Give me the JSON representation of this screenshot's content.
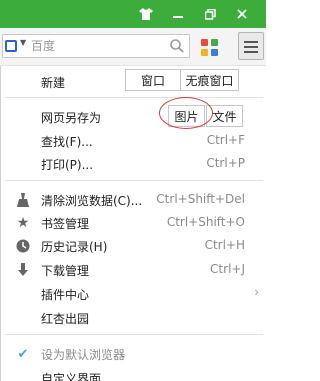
{
  "titlebar": {
    "bg_color": "#3cad3a",
    "icons": [
      "shirt-icon",
      "minimize-icon",
      "restore-icon",
      "close-icon"
    ]
  },
  "toolbar": {
    "search_placeholder": "百度",
    "engine_icon": "baidu-paw-icon"
  },
  "menu": {
    "new_label": "新建",
    "new_window": "窗口",
    "new_incognito": "无痕窗口",
    "save_page_label": "网页另存为",
    "save_image": "图片",
    "save_file": "文件",
    "find_label": "查找(F)...",
    "find_shortcut": "Ctrl+F",
    "print_label": "打印(P)...",
    "print_shortcut": "Ctrl+P",
    "clear_label": "清除浏览数据(C)...",
    "clear_shortcut": "Ctrl+Shift+Del",
    "bookmarks_label": "书签管理",
    "bookmarks_shortcut": "Ctrl+Shift+O",
    "history_label": "历史记录(H)",
    "history_shortcut": "Ctrl+H",
    "downloads_label": "下载管理",
    "downloads_shortcut": "Ctrl+J",
    "plugins_label": "插件中心",
    "redapple_label": "红杏出园",
    "default_label": "设为默认浏览器",
    "custom_label": "自定义界面"
  },
  "colors": {
    "accent": "#3cad3a",
    "highlight_circle": "#d83a3a"
  }
}
